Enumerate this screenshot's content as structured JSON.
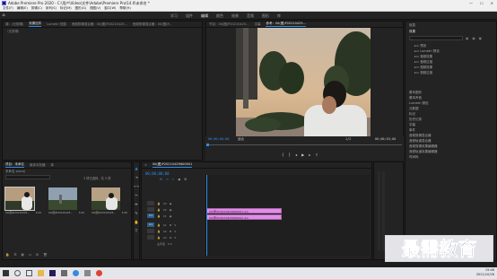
{
  "window": {
    "title": "Adobe Premiere Pro 2020 - C:\\用户\\Video\\文件\\Adobe\\Premiere Pro\\14.0\\未命名 *"
  },
  "menu": [
    "文件(F)",
    "编辑(E)",
    "剪辑(C)",
    "序列(S)",
    "标记(M)",
    "图形(G)",
    "视图(V)",
    "窗口(W)",
    "帮助(H)"
  ],
  "workspaces": {
    "tabs": [
      "学习",
      "组件",
      "编辑",
      "颜色",
      "效果",
      "音频",
      "图形",
      "库"
    ],
    "active_index": 2
  },
  "source_monitor": {
    "tabs": [
      "源：(无剪辑)",
      "效果控件",
      "Lumetri 范围",
      "音频剪辑混合器：00(图)P20210425...",
      "音频剪辑混合器：00(图)P..."
    ],
    "active_index": 1,
    "row_label": "（无剪辑）"
  },
  "program_monitor": {
    "tabs": [
      "节目：00(图)P20210425...",
      "字幕",
      "参考：00(图)P20210425..."
    ],
    "current_tc": "00;00;00;00",
    "fit": "适合",
    "quality": "1/2",
    "duration_tc": "00;00;03;00"
  },
  "right_panel": {
    "top_title": "信息",
    "header": "效果",
    "tree": [
      "预设",
      "Lumetri 预设",
      "音频效果",
      "音频过渡",
      "视频效果",
      "视频过渡"
    ],
    "sections": [
      "基本图形",
      "基本声音",
      "Lumetri 颜色",
      "元数据",
      "标记",
      "历史记录",
      "字幕",
      "事件",
      "音频剪辑混合器",
      "音频轨道混合器",
      "音频剪辑效果编辑器",
      "音频轨道效果编辑器",
      "时间码"
    ]
  },
  "project": {
    "tabs": [
      "项目：未命名",
      "媒体浏览器",
      "库"
    ],
    "path": "未命名.prproj",
    "count": "3 项已选择，共 3 项",
    "items": [
      {
        "name": "00(图)P20210425...",
        "duration": "5;00"
      },
      {
        "name": "00(图)P20210425...",
        "duration": "5;00"
      },
      {
        "name": "00(图)P20210425...",
        "duration": "5;00"
      }
    ]
  },
  "timeline": {
    "tab": "00(图)P20210425N00001",
    "timecode": "00;00;00;00",
    "ruler": [
      "00;00",
      "00;00;05;00",
      "00;00;10;00"
    ],
    "tracks": [
      {
        "target": "",
        "name": "V3"
      },
      {
        "target": "",
        "name": "V2"
      },
      {
        "target": "V1",
        "name": "V1"
      },
      {
        "target": "A1",
        "name": "A1"
      },
      {
        "target": "",
        "name": "A2"
      },
      {
        "target": "",
        "name": "A3"
      },
      {
        "target": "",
        "name": "主声道",
        "level": "0.0"
      }
    ],
    "clips": [
      "00(图)P20210425N00001.jpg",
      "00(图)P20210425N00002.jpg"
    ]
  },
  "taskbar": {
    "time": "15:46",
    "date": "2021/10/26"
  },
  "watermark": {
    "text": "最需教育"
  },
  "colors": {
    "accent": "#2d8ceb",
    "clip": "#dd8fe1"
  }
}
